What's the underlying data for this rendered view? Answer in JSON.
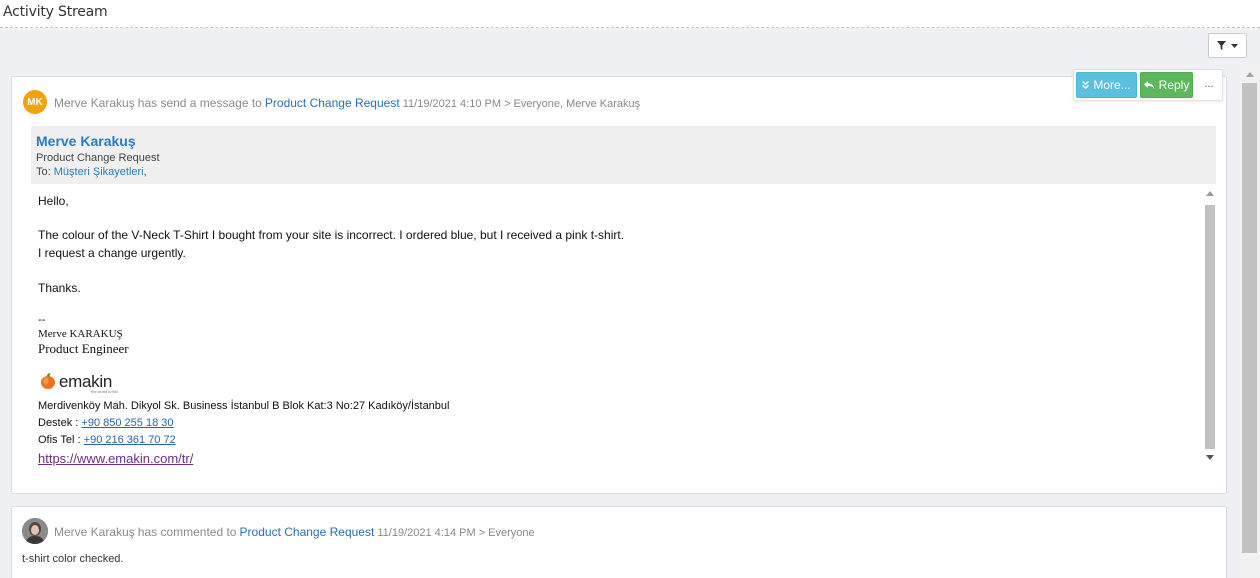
{
  "header": {
    "title": "Activity Stream"
  },
  "toolbar": {
    "filter_icon": "filter-icon",
    "dropdown_icon": "caret-down-icon"
  },
  "post1": {
    "avatar_initials": "MK",
    "author": "Merve Karakuş",
    "verb": "has send a message to",
    "target": "Product Change Request",
    "date": "11/19/2021 4:10 PM",
    "audience": "> Everyone, Merve Karakuş",
    "actions": {
      "more_label": "More...",
      "reply_label": "Reply",
      "dots_label": "..."
    },
    "mail": {
      "from": "Merve Karakuş",
      "subject": "Product Change Request",
      "to_prefix": "To:",
      "to_recipient": "Müşteri Şikayetleri",
      "to_suffix": ",",
      "greeting": "Hello,",
      "line1": "The colour of the V-Neck T-Shirt I bought from your site is incorrect. I ordered blue, but I received a pink t-shirt.",
      "line2": "I request a change urgently.",
      "closing": "Thanks.",
      "sig_dash": "--",
      "sig_name": "Merve KARAKUŞ",
      "sig_title": "Product Engineer",
      "logo_text": "emakin",
      "logo_tagline": "the world is flat",
      "address": "Merdivenköy Mah. Dikyol Sk. Business İstanbul B Blok Kat:3 No:27 Kadıköy/İstanbul",
      "support_label": "Destek :",
      "support_phone": "+90 850 255 18 30",
      "office_label": "Ofis Tel :",
      "office_phone": "+90 216 361 70 72",
      "website": "https://www.emakin.com/tr/"
    }
  },
  "post2": {
    "author": "Merve Karakuş",
    "verb": "has commented to",
    "target": "Product Change Request",
    "date": "11/19/2021 4:14 PM",
    "audience": "> Everyone",
    "text": "t-shirt color checked."
  },
  "colors": {
    "accent": "#2a7bbf",
    "more": "#5bc0de",
    "reply": "#5cb85c",
    "avatar": "#f0a30a"
  }
}
